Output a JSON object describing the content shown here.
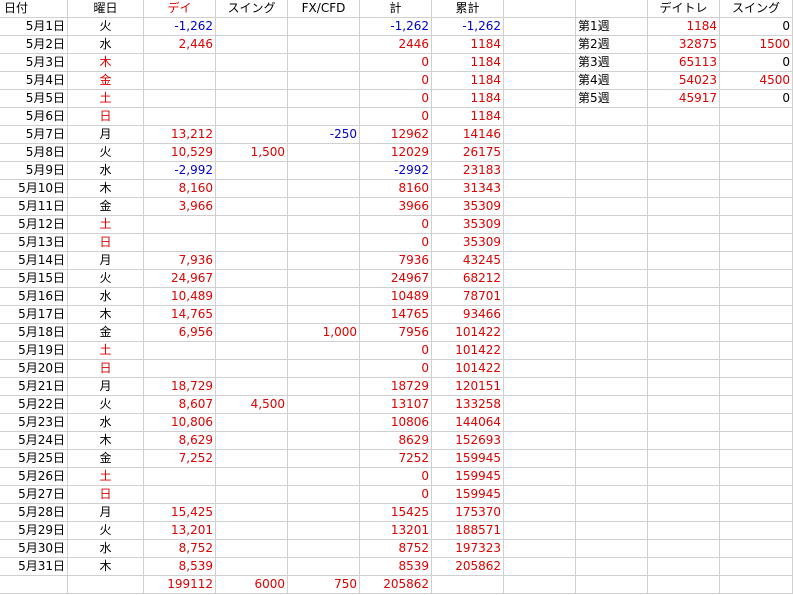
{
  "headers": {
    "date": "日付",
    "weekday": "曜日",
    "day": "デイ",
    "swing": "スイング",
    "fx": "FX/CFD",
    "total": "計",
    "cumulative": "累計",
    "summary_day": "デイトレ",
    "summary_swing": "スイング"
  },
  "colors": {
    "positive": "#e00000",
    "negative": "#0000d0",
    "weekend": "#e00000",
    "text": "#000000"
  },
  "rows": [
    {
      "date": "5月1日",
      "weekday": "火",
      "day": "-1,262",
      "swing": "",
      "fx": "",
      "total": "-1,262",
      "cumulative": "-1,262",
      "weekend": false
    },
    {
      "date": "5月2日",
      "weekday": "水",
      "day": "2,446",
      "swing": "",
      "fx": "",
      "total": "2446",
      "cumulative": "1184",
      "weekend": false
    },
    {
      "date": "5月3日",
      "weekday": "木",
      "day": "",
      "swing": "",
      "fx": "",
      "total": "0",
      "cumulative": "1184",
      "weekend": true
    },
    {
      "date": "5月4日",
      "weekday": "金",
      "day": "",
      "swing": "",
      "fx": "",
      "total": "0",
      "cumulative": "1184",
      "weekend": true
    },
    {
      "date": "5月5日",
      "weekday": "土",
      "day": "",
      "swing": "",
      "fx": "",
      "total": "0",
      "cumulative": "1184",
      "weekend": true
    },
    {
      "date": "5月6日",
      "weekday": "日",
      "day": "",
      "swing": "",
      "fx": "",
      "total": "0",
      "cumulative": "1184",
      "weekend": true
    },
    {
      "date": "5月7日",
      "weekday": "月",
      "day": "13,212",
      "swing": "",
      "fx": "-250",
      "total": "12962",
      "cumulative": "14146",
      "weekend": false
    },
    {
      "date": "5月8日",
      "weekday": "火",
      "day": "10,529",
      "swing": "1,500",
      "fx": "",
      "total": "12029",
      "cumulative": "26175",
      "weekend": false
    },
    {
      "date": "5月9日",
      "weekday": "水",
      "day": "-2,992",
      "swing": "",
      "fx": "",
      "total": "-2992",
      "cumulative": "23183",
      "weekend": false
    },
    {
      "date": "5月10日",
      "weekday": "木",
      "day": "8,160",
      "swing": "",
      "fx": "",
      "total": "8160",
      "cumulative": "31343",
      "weekend": false
    },
    {
      "date": "5月11日",
      "weekday": "金",
      "day": "3,966",
      "swing": "",
      "fx": "",
      "total": "3966",
      "cumulative": "35309",
      "weekend": false
    },
    {
      "date": "5月12日",
      "weekday": "土",
      "day": "",
      "swing": "",
      "fx": "",
      "total": "0",
      "cumulative": "35309",
      "weekend": true
    },
    {
      "date": "5月13日",
      "weekday": "日",
      "day": "",
      "swing": "",
      "fx": "",
      "total": "0",
      "cumulative": "35309",
      "weekend": true
    },
    {
      "date": "5月14日",
      "weekday": "月",
      "day": "7,936",
      "swing": "",
      "fx": "",
      "total": "7936",
      "cumulative": "43245",
      "weekend": false
    },
    {
      "date": "5月15日",
      "weekday": "火",
      "day": "24,967",
      "swing": "",
      "fx": "",
      "total": "24967",
      "cumulative": "68212",
      "weekend": false
    },
    {
      "date": "5月16日",
      "weekday": "水",
      "day": "10,489",
      "swing": "",
      "fx": "",
      "total": "10489",
      "cumulative": "78701",
      "weekend": false
    },
    {
      "date": "5月17日",
      "weekday": "木",
      "day": "14,765",
      "swing": "",
      "fx": "",
      "total": "14765",
      "cumulative": "93466",
      "weekend": false
    },
    {
      "date": "5月18日",
      "weekday": "金",
      "day": "6,956",
      "swing": "",
      "fx": "1,000",
      "total": "7956",
      "cumulative": "101422",
      "weekend": false
    },
    {
      "date": "5月19日",
      "weekday": "土",
      "day": "",
      "swing": "",
      "fx": "",
      "total": "0",
      "cumulative": "101422",
      "weekend": true
    },
    {
      "date": "5月20日",
      "weekday": "日",
      "day": "",
      "swing": "",
      "fx": "",
      "total": "0",
      "cumulative": "101422",
      "weekend": true
    },
    {
      "date": "5月21日",
      "weekday": "月",
      "day": "18,729",
      "swing": "",
      "fx": "",
      "total": "18729",
      "cumulative": "120151",
      "weekend": false
    },
    {
      "date": "5月22日",
      "weekday": "火",
      "day": "8,607",
      "swing": "4,500",
      "fx": "",
      "total": "13107",
      "cumulative": "133258",
      "weekend": false
    },
    {
      "date": "5月23日",
      "weekday": "水",
      "day": "10,806",
      "swing": "",
      "fx": "",
      "total": "10806",
      "cumulative": "144064",
      "weekend": false
    },
    {
      "date": "5月24日",
      "weekday": "木",
      "day": "8,629",
      "swing": "",
      "fx": "",
      "total": "8629",
      "cumulative": "152693",
      "weekend": false
    },
    {
      "date": "5月25日",
      "weekday": "金",
      "day": "7,252",
      "swing": "",
      "fx": "",
      "total": "7252",
      "cumulative": "159945",
      "weekend": false
    },
    {
      "date": "5月26日",
      "weekday": "土",
      "day": "",
      "swing": "",
      "fx": "",
      "total": "0",
      "cumulative": "159945",
      "weekend": true
    },
    {
      "date": "5月27日",
      "weekday": "日",
      "day": "",
      "swing": "",
      "fx": "",
      "total": "0",
      "cumulative": "159945",
      "weekend": true
    },
    {
      "date": "5月28日",
      "weekday": "月",
      "day": "15,425",
      "swing": "",
      "fx": "",
      "total": "15425",
      "cumulative": "175370",
      "weekend": false
    },
    {
      "date": "5月29日",
      "weekday": "火",
      "day": "13,201",
      "swing": "",
      "fx": "",
      "total": "13201",
      "cumulative": "188571",
      "weekend": false
    },
    {
      "date": "5月30日",
      "weekday": "水",
      "day": "8,752",
      "swing": "",
      "fx": "",
      "total": "8752",
      "cumulative": "197323",
      "weekend": false
    },
    {
      "date": "5月31日",
      "weekday": "木",
      "day": "8,539",
      "swing": "",
      "fx": "",
      "total": "8539",
      "cumulative": "205862",
      "weekend": false
    }
  ],
  "totals": {
    "day": "199112",
    "swing": "6000",
    "fx": "750",
    "total": "205862"
  },
  "weeks": [
    {
      "label": "第1週",
      "day": "1184",
      "swing": "0"
    },
    {
      "label": "第2週",
      "day": "32875",
      "swing": "1500"
    },
    {
      "label": "第3週",
      "day": "65113",
      "swing": "0"
    },
    {
      "label": "第4週",
      "day": "54023",
      "swing": "4500"
    },
    {
      "label": "第5週",
      "day": "45917",
      "swing": "0"
    }
  ]
}
